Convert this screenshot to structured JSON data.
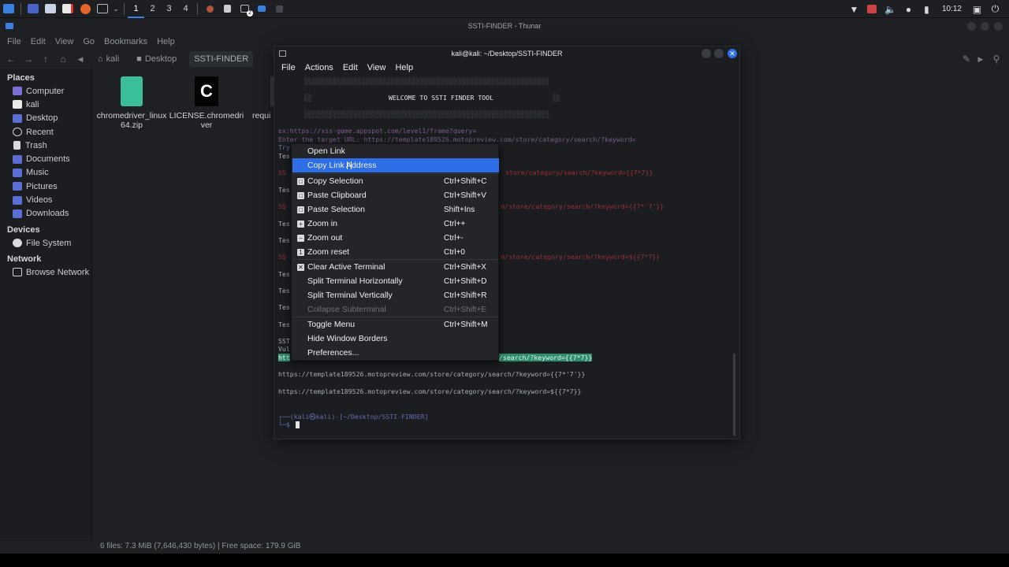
{
  "panel": {
    "workspaces": [
      "1",
      "2",
      "3",
      "4"
    ],
    "active_workspace": "1",
    "clock": "10:12",
    "notification_badge": "2"
  },
  "thunar": {
    "title": "SSTI-FINDER - Thunar",
    "menu": [
      "File",
      "Edit",
      "View",
      "Go",
      "Bookmarks",
      "Help"
    ],
    "breadcrumbs": [
      "kali",
      "Desktop",
      "SSTI-FINDER"
    ],
    "sidebar": {
      "places_label": "Places",
      "places": [
        "Computer",
        "kali",
        "Desktop",
        "Recent",
        "Trash",
        "Documents",
        "Music",
        "Pictures",
        "Videos",
        "Downloads"
      ],
      "devices_label": "Devices",
      "devices": [
        "File System"
      ],
      "network_label": "Network",
      "network": [
        "Browse Network"
      ]
    },
    "files": [
      {
        "name_line1": "chromedriver_linux",
        "name_line2": "64.zip",
        "icon": "zip-icon"
      },
      {
        "name_line1": "LICENSE.chromedri",
        "name_line2": "ver",
        "icon": "license-icon"
      },
      {
        "name_line1": "requi",
        "name_line2": "",
        "icon": "file-icon"
      }
    ],
    "status": "6 files: 7.3 MiB (7,646,430 bytes)  |  Free space: 179.9 GiB"
  },
  "terminal": {
    "title": "kali@kali: ~/Desktop/SSTI-FINDER",
    "menu": [
      "File",
      "Actions",
      "Edit",
      "View",
      "Help"
    ],
    "banner_border": "░░░░░░░░░░░░░░░░░░░░░░░░░░░░░░░░░░░░░░░░░░░░░░░░░░░░░░░░░░░░░░░",
    "banner_text": "WELCOME TO SSTI FINDER TOOL",
    "banner_side": "░░",
    "example_line": "ex:https://xss-game.appspot.com/level1/frame?query=",
    "target_prompt": "Enter the target URL: https://template189526.motopreview.com/store/category/search/?keyword=",
    "frag_try": "Try",
    "frag_tes": "Tes",
    "frag_ss": "SS",
    "red_partial_1": "store/category/search/?keyword={{7*7}}",
    "red_partial_2": "m/store/category/search/?keyword={{7*'7'}}",
    "red_partial_3": "m/store/category/search/?keyword=${{7*7}}",
    "frag_sst": "SST",
    "frag_vul": "Vul",
    "highlight_start": "htt",
    "highlight_tail": "/search/?keyword={{7*7}}",
    "result_line_2": "https://template189526.motopreview.com/store/category/search/?keyword={{7*'7'}}",
    "result_line_3": "https://template189526.motopreview.com/store/category/search/?keyword=${{7*7}}",
    "prompt_line1": "┌──(kali㉿kali)-[~/Desktop/SSTI-FINDER]",
    "prompt_line2": "└─$"
  },
  "context_menu": {
    "items": [
      {
        "label": "Open Link",
        "shortcut": "",
        "icon": "none",
        "state": "normal"
      },
      {
        "label": "Copy Link Address",
        "shortcut": "",
        "icon": "none",
        "state": "selected"
      },
      {
        "label": "Copy Selection",
        "shortcut": "Ctrl+Shift+C",
        "icon": "copy-icon",
        "state": "normal"
      },
      {
        "label": "Paste Clipboard",
        "shortcut": "Ctrl+Shift+V",
        "icon": "paste-icon",
        "state": "normal"
      },
      {
        "label": "Paste Selection",
        "shortcut": "Shift+Ins",
        "icon": "paste-icon",
        "state": "normal"
      },
      {
        "label": "Zoom in",
        "shortcut": "Ctrl++",
        "icon": "zoom-in-icon",
        "state": "normal"
      },
      {
        "label": "Zoom out",
        "shortcut": "Ctrl+-",
        "icon": "zoom-out-icon",
        "state": "normal"
      },
      {
        "label": "Zoom reset",
        "shortcut": "Ctrl+0",
        "icon": "zoom-reset-icon",
        "state": "normal"
      },
      {
        "label": "Clear Active Terminal",
        "shortcut": "Ctrl+Shift+X",
        "icon": "clear-icon",
        "state": "normal"
      },
      {
        "label": "Split Terminal Horizontally",
        "shortcut": "Ctrl+Shift+D",
        "icon": "none",
        "state": "normal"
      },
      {
        "label": "Split Terminal Vertically",
        "shortcut": "Ctrl+Shift+R",
        "icon": "none",
        "state": "normal"
      },
      {
        "label": "Collapse Subterminal",
        "shortcut": "Ctrl+Shift+E",
        "icon": "none",
        "state": "disabled"
      },
      {
        "label": "Toggle Menu",
        "shortcut": "Ctrl+Shift+M",
        "icon": "none",
        "state": "normal"
      },
      {
        "label": "Hide Window Borders",
        "shortcut": "",
        "icon": "none",
        "state": "normal"
      },
      {
        "label": "Preferences...",
        "shortcut": "",
        "icon": "none",
        "state": "normal"
      }
    ]
  },
  "colors": {
    "accent": "#2e6ee6",
    "terminal_bg": "#1b1d21",
    "highlight": "#2d8f6e",
    "red_text": "#9a2f35"
  }
}
